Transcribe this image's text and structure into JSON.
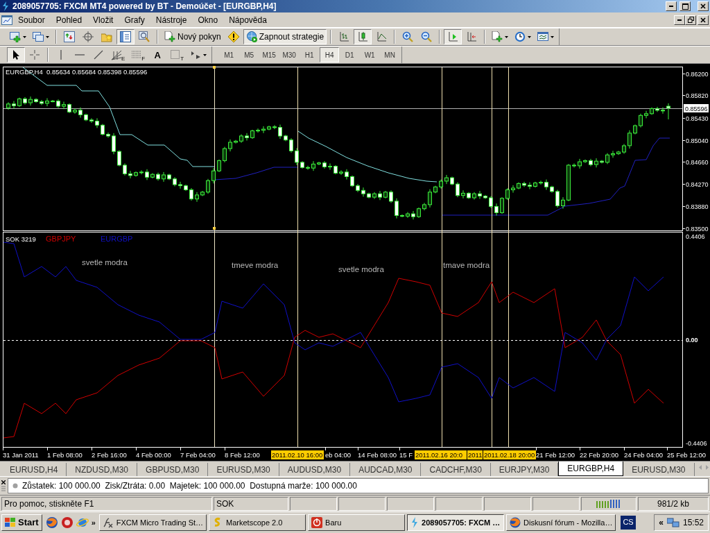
{
  "window": {
    "title": "2089057705: FXCM MT4 powered by BT - Demoúčet - [EURGBP,H4]"
  },
  "menu": [
    "Soubor",
    "Pohled",
    "Vložit",
    "Grafy",
    "Nástroje",
    "Okno",
    "Nápověda"
  ],
  "toolbar": {
    "items": [
      {
        "kind": "icon",
        "pressed": false
      },
      {
        "kind": "icon",
        "pressed": false
      },
      {
        "kind": "separator"
      },
      {
        "kind": "icon",
        "pressed": false
      },
      {
        "kind": "icon",
        "pressed": false
      },
      {
        "kind": "icon",
        "pressed": false
      },
      {
        "kind": "icon",
        "pressed": true
      },
      {
        "kind": "icon",
        "pressed": false
      },
      {
        "kind": "separator"
      },
      {
        "kind": "text",
        "label": "Nový pokyn",
        "pressed": false
      },
      {
        "kind": "icon",
        "pressed": false
      },
      {
        "kind": "text",
        "label": "Zapnout strategie",
        "pressed": true
      },
      {
        "kind": "separator"
      },
      {
        "kind": "icon",
        "pressed": false
      },
      {
        "kind": "icon",
        "pressed": true
      },
      {
        "kind": "icon",
        "pressed": false
      },
      {
        "kind": "separator"
      },
      {
        "kind": "icon",
        "pressed": false
      },
      {
        "kind": "icon",
        "pressed": false
      },
      {
        "kind": "separator"
      },
      {
        "kind": "icon",
        "pressed": true
      },
      {
        "kind": "icon",
        "pressed": false
      },
      {
        "kind": "separator"
      },
      {
        "kind": "icon",
        "pressed": false
      },
      {
        "kind": "icon",
        "pressed": false
      },
      {
        "kind": "icon",
        "pressed": false
      }
    ]
  },
  "toolbar2": {
    "items": [
      {
        "kind": "icon",
        "pressed": true
      },
      {
        "kind": "icon",
        "pressed": false
      },
      {
        "kind": "separator"
      },
      {
        "kind": "icon",
        "pressed": false
      },
      {
        "kind": "icon",
        "pressed": false
      },
      {
        "kind": "icon",
        "pressed": false
      },
      {
        "kind": "icon",
        "label": "E",
        "pressed": false
      },
      {
        "kind": "icon",
        "label": "F",
        "pressed": false
      },
      {
        "kind": "text",
        "label": "A",
        "pressed": false
      },
      {
        "kind": "icon",
        "label": "T",
        "pressed": false
      },
      {
        "kind": "icon",
        "pressed": false
      }
    ],
    "timeframes": [
      {
        "label": "M1",
        "selected": false
      },
      {
        "label": "M5",
        "selected": false
      },
      {
        "label": "M15",
        "selected": false
      },
      {
        "label": "M30",
        "selected": false
      },
      {
        "label": "H1",
        "selected": false
      },
      {
        "label": "H4",
        "selected": true
      },
      {
        "label": "D1",
        "selected": false
      },
      {
        "label": "W1",
        "selected": false
      },
      {
        "label": "MN",
        "selected": false
      }
    ]
  },
  "chart": {
    "symbol": "EURGBP,H4",
    "quote": "0.85634 0.85684 0.85398 0.85596",
    "current_price": "0.85596",
    "chart_data": {
      "type": "candlestick",
      "ylim": [
        0.8346,
        0.8631
      ],
      "yticks": [
        {
          "value": 0.862,
          "label": "0.86200"
        },
        {
          "value": 0.8582,
          "label": "0.85820"
        },
        {
          "value": 0.8543,
          "label": "0.85430"
        },
        {
          "value": 0.8504,
          "label": "0.85040"
        },
        {
          "value": 0.8466,
          "label": "0.84660"
        },
        {
          "value": 0.8427,
          "label": "0.84270"
        },
        {
          "value": 0.8388,
          "label": "0.83880"
        },
        {
          "value": 0.835,
          "label": "0.83500"
        }
      ],
      "categories": [
        null,
        null,
        null,
        null,
        null,
        null,
        null,
        null,
        null,
        null,
        null,
        null,
        null,
        null,
        null,
        null,
        null,
        null,
        null,
        null,
        null,
        null,
        null,
        null,
        null,
        null,
        null,
        null,
        null,
        null,
        null,
        null,
        null,
        null,
        null,
        null,
        null,
        null,
        null,
        null,
        null,
        null,
        null,
        null,
        null,
        null,
        null,
        null,
        null,
        null,
        null,
        null,
        null,
        null,
        null,
        null,
        null,
        null,
        null,
        null,
        null,
        null,
        null,
        null,
        null,
        null,
        null,
        null,
        null,
        null,
        null,
        null,
        null,
        null,
        null,
        null,
        null,
        null,
        null,
        null,
        null,
        null,
        null,
        null,
        null,
        null,
        null,
        null,
        null,
        null,
        null,
        null,
        null,
        null,
        null,
        null,
        null,
        null,
        null,
        null,
        null,
        null,
        null,
        null,
        null,
        null,
        null,
        null,
        null,
        null,
        null,
        null,
        null,
        null,
        null,
        null,
        null,
        null,
        null,
        null
      ],
      "ohlc": [
        [
          0.856,
          0.857,
          0.8557,
          0.8567
        ],
        [
          0.8567,
          0.8572,
          0.8559,
          0.8564
        ],
        [
          0.8564,
          0.8578,
          0.8562,
          0.8576
        ],
        [
          0.8576,
          0.8579,
          0.8566,
          0.8569
        ],
        [
          0.8569,
          0.858,
          0.8564,
          0.8575
        ],
        [
          0.8575,
          0.8577,
          0.8569,
          0.8571
        ],
        [
          0.8571,
          0.8574,
          0.8565,
          0.8568
        ],
        [
          0.8568,
          0.8577,
          0.8563,
          0.8572
        ],
        [
          0.8572,
          0.8574,
          0.857,
          0.8572
        ],
        [
          0.8572,
          0.8575,
          0.856,
          0.8563
        ],
        [
          0.8563,
          0.8571,
          0.8558,
          0.8566
        ],
        [
          0.8566,
          0.8568,
          0.8551,
          0.8553
        ],
        [
          0.8553,
          0.8559,
          0.855,
          0.8556
        ],
        [
          0.8556,
          0.8561,
          0.8543,
          0.8548
        ],
        [
          0.8548,
          0.855,
          0.8537,
          0.8539
        ],
        [
          0.8539,
          0.8542,
          0.8534,
          0.8537
        ],
        [
          0.8537,
          0.8542,
          0.8525,
          0.853
        ],
        [
          0.853,
          0.8532,
          0.8512,
          0.8514
        ],
        [
          0.8514,
          0.8517,
          0.8508,
          0.8511
        ],
        [
          0.8511,
          0.8516,
          0.8479,
          0.8484
        ],
        [
          0.8484,
          0.8486,
          0.8458,
          0.846
        ],
        [
          0.846,
          0.8463,
          0.8442,
          0.8445
        ],
        [
          0.8445,
          0.845,
          0.8437,
          0.8442
        ],
        [
          0.8442,
          0.8449,
          0.844,
          0.8447
        ],
        [
          0.8447,
          0.8451,
          0.8444,
          0.8448
        ],
        [
          0.8448,
          0.8453,
          0.8434,
          0.8439
        ],
        [
          0.8439,
          0.8446,
          0.8437,
          0.8444
        ],
        [
          0.8444,
          0.8447,
          0.8433,
          0.8436
        ],
        [
          0.8436,
          0.8448,
          0.8431,
          0.8443
        ],
        [
          0.8443,
          0.8445,
          0.8434,
          0.8436
        ],
        [
          0.8436,
          0.8439,
          0.8423,
          0.8426
        ],
        [
          0.8426,
          0.8431,
          0.8419,
          0.8424
        ],
        [
          0.8424,
          0.8426,
          0.8415,
          0.8417
        ],
        [
          0.8417,
          0.842,
          0.8398,
          0.8401
        ],
        [
          0.8401,
          0.8413,
          0.8396,
          0.8408
        ],
        [
          0.8408,
          0.8415,
          0.8406,
          0.8413
        ],
        [
          0.8413,
          0.8436,
          0.841,
          0.8433
        ],
        [
          0.8433,
          0.8455,
          0.8428,
          0.845
        ],
        [
          0.845,
          0.847,
          0.8448,
          0.8468
        ],
        [
          0.8468,
          0.8492,
          0.8465,
          0.8489
        ],
        [
          0.8489,
          0.8505,
          0.8484,
          0.85
        ],
        [
          0.85,
          0.8504,
          0.8498,
          0.8502
        ],
        [
          0.8502,
          0.8514,
          0.8499,
          0.8511
        ],
        [
          0.8511,
          0.8516,
          0.8503,
          0.8508
        ],
        [
          0.8508,
          0.8522,
          0.8506,
          0.852
        ],
        [
          0.852,
          0.8524,
          0.8517,
          0.8521
        ],
        [
          0.8521,
          0.8528,
          0.8516,
          0.8523
        ],
        [
          0.8523,
          0.8529,
          0.8521,
          0.8527
        ],
        [
          0.8527,
          0.853,
          0.8523,
          0.8526
        ],
        [
          0.8526,
          0.8531,
          0.8506,
          0.8511
        ],
        [
          0.8511,
          0.8513,
          0.8502,
          0.8504
        ],
        [
          0.8504,
          0.8507,
          0.8482,
          0.8485
        ],
        [
          0.8485,
          0.849,
          0.846,
          0.8465
        ],
        [
          0.8465,
          0.8467,
          0.8454,
          0.8456
        ],
        [
          0.8456,
          0.8459,
          0.8452,
          0.8455
        ],
        [
          0.8455,
          0.8467,
          0.845,
          0.8462
        ],
        [
          0.8462,
          0.8466,
          0.846,
          0.8464
        ],
        [
          0.8464,
          0.8467,
          0.8454,
          0.8457
        ],
        [
          0.8457,
          0.8463,
          0.8452,
          0.8458
        ],
        [
          0.8458,
          0.846,
          0.8444,
          0.8446
        ],
        [
          0.8446,
          0.8451,
          0.8443,
          0.8448
        ],
        [
          0.8448,
          0.8453,
          0.8435,
          0.844
        ],
        [
          0.844,
          0.8442,
          0.8422,
          0.8424
        ],
        [
          0.8424,
          0.8427,
          0.8413,
          0.8416
        ],
        [
          0.8416,
          0.8421,
          0.8405,
          0.841
        ],
        [
          0.841,
          0.8412,
          0.8402,
          0.8404
        ],
        [
          0.8404,
          0.8413,
          0.8401,
          0.841
        ],
        [
          0.841,
          0.8415,
          0.8399,
          0.8404
        ],
        [
          0.8404,
          0.8415,
          0.8402,
          0.8413
        ],
        [
          0.8413,
          0.8416,
          0.8394,
          0.8397
        ],
        [
          0.8397,
          0.8402,
          0.8367,
          0.8372
        ],
        [
          0.8372,
          0.8374,
          0.8369,
          0.8371
        ],
        [
          0.8371,
          0.8378,
          0.8368,
          0.8375
        ],
        [
          0.8375,
          0.838,
          0.8365,
          0.837
        ],
        [
          0.837,
          0.8386,
          0.8368,
          0.8384
        ],
        [
          0.8384,
          0.8394,
          0.8381,
          0.8391
        ],
        [
          0.8391,
          0.8418,
          0.8386,
          0.8413
        ],
        [
          0.8413,
          0.8424,
          0.8411,
          0.8422
        ],
        [
          0.8422,
          0.8435,
          0.8419,
          0.8432
        ],
        [
          0.8432,
          0.8443,
          0.8427,
          0.8438
        ],
        [
          0.8438,
          0.844,
          0.8425,
          0.8427
        ],
        [
          0.8427,
          0.843,
          0.8404,
          0.8407
        ],
        [
          0.8407,
          0.8416,
          0.8402,
          0.8411
        ],
        [
          0.8411,
          0.8413,
          0.8401,
          0.8403
        ],
        [
          0.8403,
          0.8413,
          0.84,
          0.841
        ],
        [
          0.841,
          0.8415,
          0.8401,
          0.8406
        ],
        [
          0.8406,
          0.8408,
          0.8401,
          0.8403
        ],
        [
          0.8403,
          0.8406,
          0.8385,
          0.8388
        ],
        [
          0.8388,
          0.8393,
          0.8372,
          0.8377
        ],
        [
          0.8377,
          0.8404,
          0.8375,
          0.8402
        ],
        [
          0.8402,
          0.842,
          0.8399,
          0.8417
        ],
        [
          0.8417,
          0.8425,
          0.8412,
          0.842
        ],
        [
          0.842,
          0.843,
          0.8418,
          0.8428
        ],
        [
          0.8428,
          0.8431,
          0.8422,
          0.8425
        ],
        [
          0.8425,
          0.843,
          0.8418,
          0.8423
        ],
        [
          0.8423,
          0.8431,
          0.8421,
          0.8429
        ],
        [
          0.8429,
          0.8433,
          0.8426,
          0.843
        ],
        [
          0.843,
          0.8435,
          0.8417,
          0.8422
        ],
        [
          0.8422,
          0.8424,
          0.8412,
          0.8414
        ],
        [
          0.8414,
          0.8417,
          0.8386,
          0.8389
        ],
        [
          0.8389,
          0.8404,
          0.8384,
          0.8399
        ],
        [
          0.8399,
          0.8462,
          0.8397,
          0.846
        ],
        [
          0.846,
          0.8463,
          0.8456,
          0.8459
        ],
        [
          0.8459,
          0.8471,
          0.8454,
          0.8466
        ],
        [
          0.8466,
          0.847,
          0.8464,
          0.8468
        ],
        [
          0.8468,
          0.8471,
          0.8458,
          0.8461
        ],
        [
          0.8461,
          0.8472,
          0.8456,
          0.8467
        ],
        [
          0.8467,
          0.8469,
          0.8463,
          0.8465
        ],
        [
          0.8465,
          0.8481,
          0.8462,
          0.8478
        ],
        [
          0.8478,
          0.8485,
          0.8473,
          0.848
        ],
        [
          0.848,
          0.8485,
          0.8478,
          0.8483
        ],
        [
          0.8483,
          0.8497,
          0.848,
          0.8494
        ],
        [
          0.8494,
          0.8521,
          0.8489,
          0.8516
        ],
        [
          0.8516,
          0.8531,
          0.8514,
          0.8529
        ],
        [
          0.8529,
          0.855,
          0.8526,
          0.8547
        ],
        [
          0.8547,
          0.8555,
          0.8542,
          0.855
        ],
        [
          0.855,
          0.8561,
          0.8548,
          0.8559
        ],
        [
          0.8559,
          0.8562,
          0.8553,
          0.8556
        ],
        [
          0.8556,
          0.8561,
          0.855,
          0.8555
        ],
        [
          0.8563,
          0.8568,
          0.854,
          0.856
        ]
      ]
    },
    "indicator": {
      "name": "SOK 3219",
      "legend": [
        {
          "label": "GBPJPY",
          "color": "#d00000"
        },
        {
          "label": "EURGBP",
          "color": "#1010c8"
        }
      ],
      "axis": [
        "0.4406",
        "0.00",
        "-0.4406"
      ]
    },
    "notes": [
      "svetle modra",
      "tmeve modra",
      "svetle modra",
      "tmave modra"
    ],
    "time_axis": [
      "31 Jan 2011",
      "1 Feb 08:00",
      "2 Feb 16:00",
      "4 Feb 00:00",
      "7 Feb 04:00",
      "8 Feb 12:00",
      "eb 04:00",
      "14 Feb 08:00",
      "15 F",
      "21 Feb 12:00",
      "22 Feb 20:00",
      "24 Feb 04:00",
      "25 Feb 12:00"
    ],
    "markers": [
      {
        "label": "2011.02.10 16:00"
      },
      {
        "label": "2011.02.16 20:0"
      },
      {
        "label": "2011"
      },
      {
        "label": "2011.02.18 20:00"
      }
    ]
  },
  "tabs": [
    {
      "label": "EURUSD,H4",
      "selected": false
    },
    {
      "label": "NZDUSD,M30",
      "selected": false
    },
    {
      "label": "GBPUSD,M30",
      "selected": false
    },
    {
      "label": "EURUSD,M30",
      "selected": false
    },
    {
      "label": "AUDUSD,M30",
      "selected": false
    },
    {
      "label": "AUDCAD,M30",
      "selected": false
    },
    {
      "label": "CADCHF,M30",
      "selected": false
    },
    {
      "label": "EURJPY,M30",
      "selected": false
    },
    {
      "label": "EURGBP,H4",
      "selected": true
    },
    {
      "label": "EURUSD,M30",
      "selected": false
    }
  ],
  "terminal": {
    "summary": "Zůstatek: 100 000.00  Zisk/Ztráta: 0.00  Majetek: 100 000.00  Dostupná marže: 100 000.00"
  },
  "status_bar": {
    "help": "Pro pomoc, stiskněte F1",
    "profile": "SOK",
    "traffic": "981/2 kb"
  },
  "taskbar": {
    "start": "Start",
    "more": "»",
    "tasks": [
      {
        "label": "FXCM Micro Trading St…",
        "selected": false
      },
      {
        "label": "Marketscope 2.0",
        "selected": false
      },
      {
        "label": "Baru",
        "selected": false
      },
      {
        "label": "2089057705: FXCM …",
        "selected": true
      },
      {
        "label": "Diskusní fórum - Mozilla…",
        "selected": false
      }
    ],
    "language": "CS",
    "tray_expand": "«",
    "clock": "15:52"
  }
}
